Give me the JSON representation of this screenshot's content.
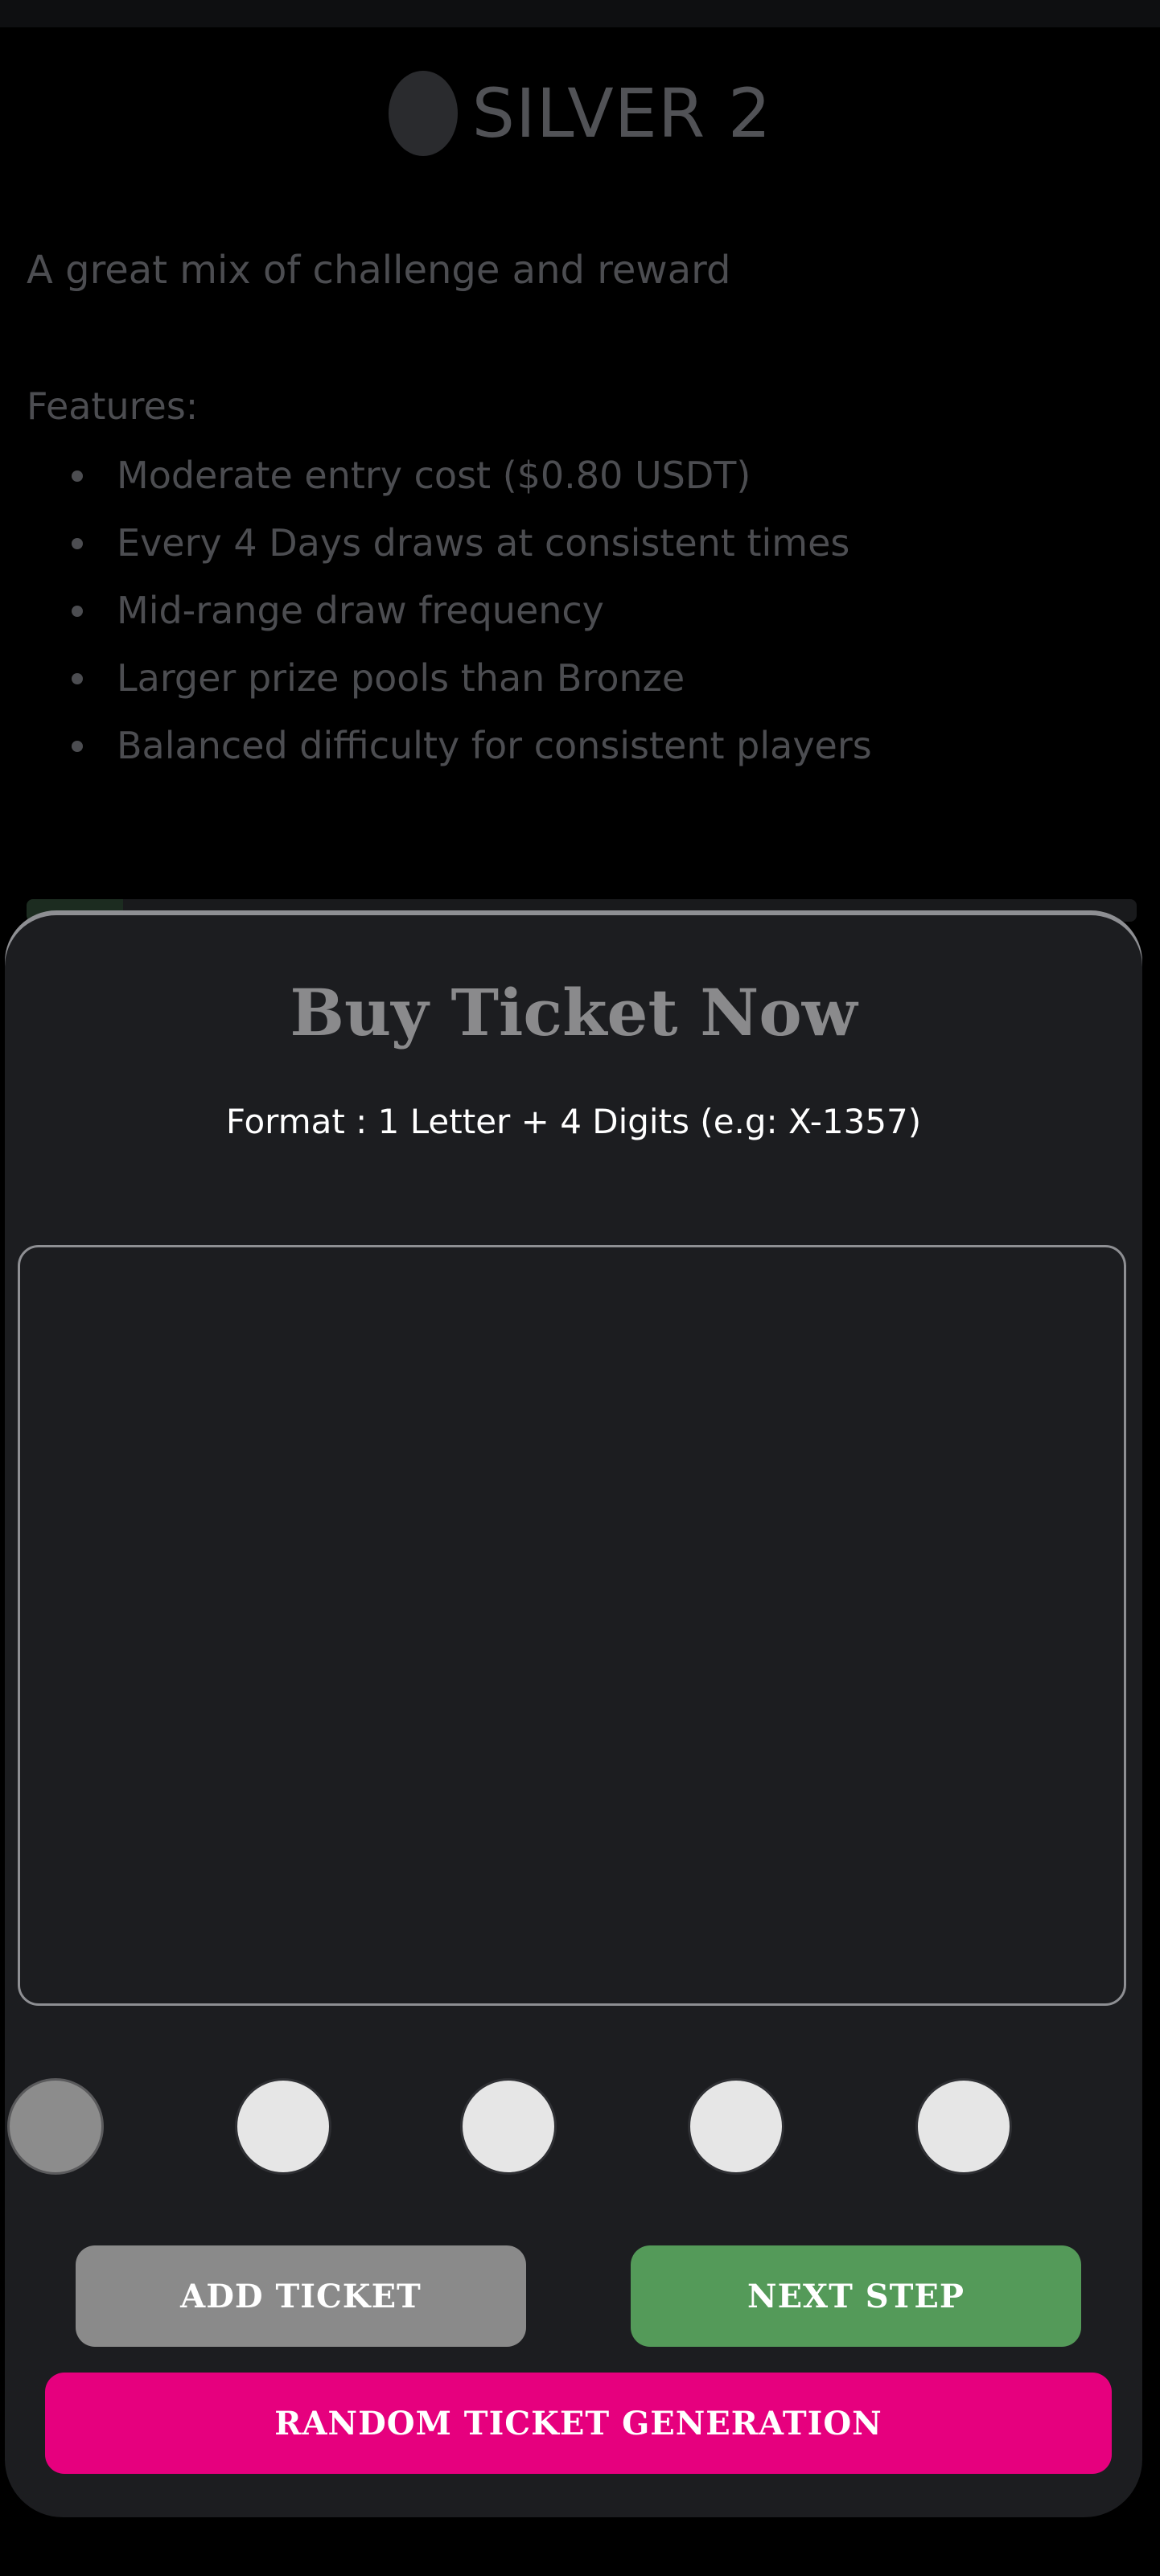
{
  "background_page": {
    "tier_icon": "silver-medal-icon",
    "tier_name": "SILVER 2",
    "tagline": "A great mix of challenge and reward",
    "features_label": "Features:",
    "features": [
      "Moderate entry cost ($0.80 USDT)",
      "Every 4 Days draws at consistent times",
      "Mid-range draw frequency",
      "Larger prize pools than Bronze",
      "Balanced difficulty for consistent players"
    ]
  },
  "modal": {
    "title": "Buy Ticket Now",
    "format_hint": "Format : 1 Letter + 4 Digits (e.g: X-1357)",
    "ticket_input_value": "",
    "slots_count": 5,
    "active_slot_index": 0,
    "buttons": {
      "add_ticket": "ADD TICKET",
      "next_step": "NEXT STEP",
      "random_generation": "RANDOM TICKET GENERATION"
    }
  },
  "colors": {
    "sheet_background": "#1c1d20",
    "next_step": "#549a59",
    "add_ticket": "#8a8a8a",
    "random_generation": "#e6007e"
  }
}
